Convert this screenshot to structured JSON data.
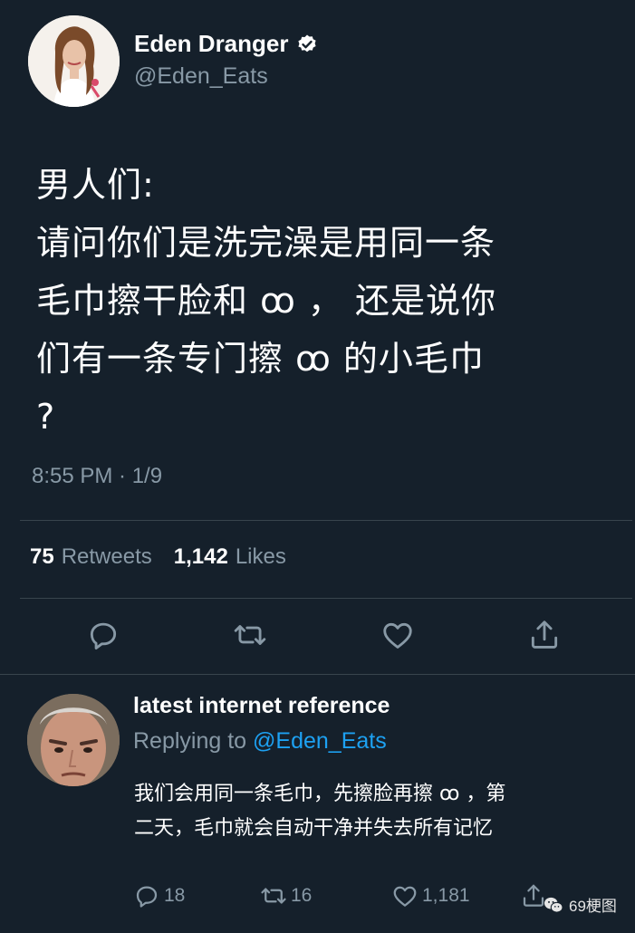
{
  "tweet": {
    "author_name": "Eden Dranger",
    "author_handle": "@Eden_Eats",
    "text": "男人们:\n请问你们是洗完澡是用同一条\n毛巾擦干脸和 ꝏ ， 还是说你\n们有一条专门擦 ꝏ 的小毛巾\n?",
    "timestamp": "8:55 PM · 1/9",
    "retweets_count": "75",
    "retweets_label": "Retweets",
    "likes_count": "1,142",
    "likes_label": "Likes"
  },
  "actions": {
    "reply_icon": "reply-icon",
    "retweet_icon": "retweet-icon",
    "like_icon": "heart-icon",
    "share_icon": "share-icon"
  },
  "reply": {
    "author_name": "latest internet reference",
    "replying_label": "Replying to",
    "replying_mention": "@Eden_Eats",
    "text": "我们会用同一条毛巾，先擦脸再擦 ꝏ ，第\n二天，毛巾就会自动干净并失去所有记忆",
    "reply_count": "18",
    "retweet_count": "16",
    "like_count": "1,181"
  },
  "watermark": {
    "text": "69梗图"
  },
  "colors": {
    "background": "#15202b",
    "secondary_text": "#8899a6",
    "link": "#1da1f2",
    "divider": "#38444d",
    "verified": "#ffffff"
  }
}
